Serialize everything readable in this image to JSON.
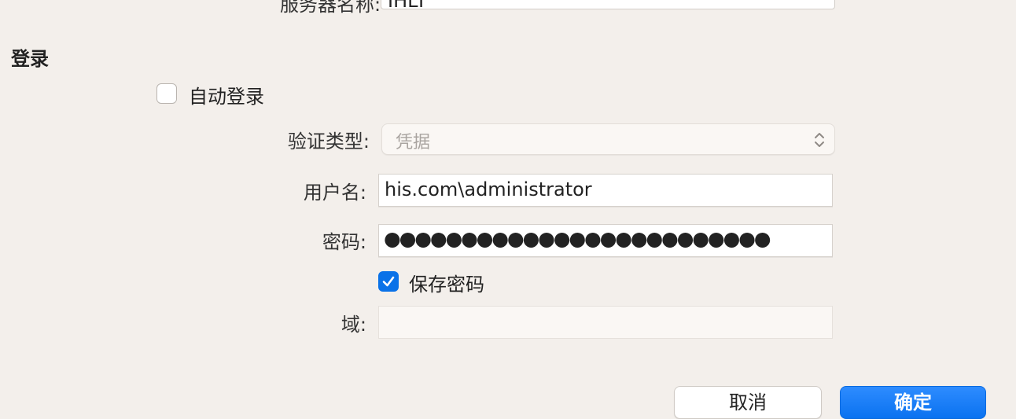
{
  "top_row": {
    "label": "服务器名称:",
    "value": "IHLT"
  },
  "login_section": {
    "title": "登录",
    "auto_login": {
      "label": "自动登录",
      "checked": false
    },
    "auth_type": {
      "label": "验证类型:",
      "value": "凭据"
    },
    "username": {
      "label": "用户名:",
      "value": "his.com\\administrator"
    },
    "password": {
      "label": "密码:",
      "value": "●●●●●●●●●●●●●●●●●●●●●●●●●"
    },
    "save_password": {
      "label": "保存密码",
      "checked": true
    },
    "domain": {
      "label": "域:",
      "value": ""
    }
  },
  "buttons": {
    "cancel_label": "取消",
    "ok_label": "确定"
  },
  "colors": {
    "background": "#f3efeb",
    "accent": "#0a72e8"
  }
}
